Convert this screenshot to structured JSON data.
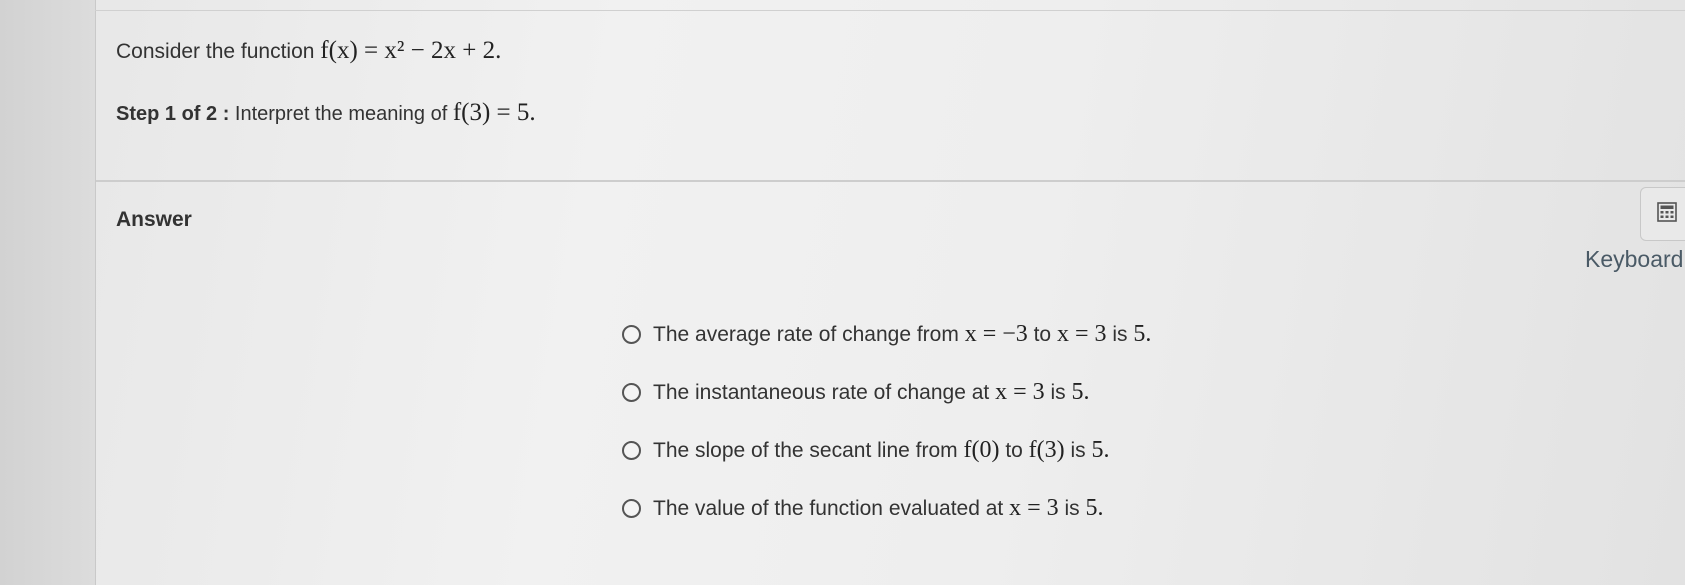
{
  "question": {
    "intro_text": "Consider the function ",
    "function_math": "f(x) = x² − 2x + 2."
  },
  "step": {
    "label": "Step 1 of 2 :",
    "text": " Interpret the meaning of ",
    "math": "f(3) = 5."
  },
  "answer": {
    "label": "Answer",
    "options": [
      {
        "parts": [
          "The average rate of change from ",
          "x = −3",
          " to ",
          "x = 3",
          " is ",
          "5."
        ]
      },
      {
        "parts": [
          "The instantaneous rate of change at ",
          "x = 3",
          " is ",
          "5."
        ]
      },
      {
        "parts": [
          "The slope of the secant line from ",
          "f(0)",
          " to ",
          "f(3)",
          " is ",
          "5."
        ]
      },
      {
        "parts": [
          "The value of the function evaluated at ",
          "x = 3",
          " is ",
          "5."
        ]
      }
    ]
  },
  "keyboard": {
    "label": "Keyboard",
    "icon": "calculator-icon"
  }
}
